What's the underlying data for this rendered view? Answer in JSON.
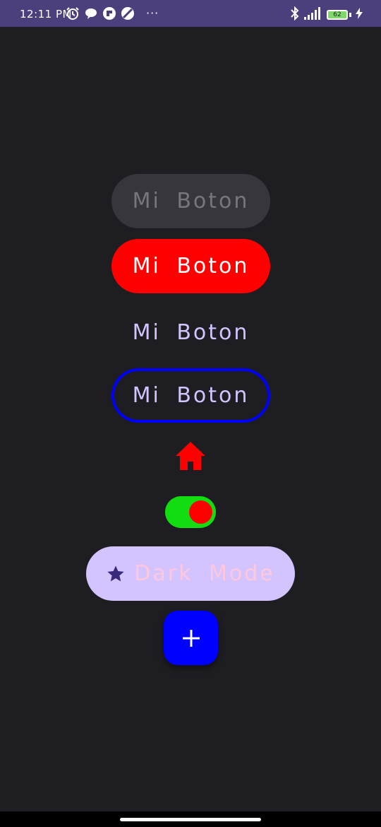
{
  "status_bar": {
    "time": "12:11 PM",
    "icons": [
      "alarm-icon",
      "chat-bubble-icon",
      "app-icon",
      "no-disturb-icon"
    ],
    "more": "···",
    "right_icons": [
      "bluetooth-icon",
      "signal-icon"
    ],
    "battery": "62",
    "charging": "lightning-icon",
    "background": "#4d3f7c"
  },
  "buttons": {
    "disabled_label": "Mi Boton",
    "filled_label": "Mi Boton",
    "text_label": "Mi Boton",
    "outlined_label": "Mi Boton"
  },
  "icon_home": {
    "name": "home-icon",
    "color": "#ff0000"
  },
  "switch": {
    "checked": true,
    "track_color": "#11dd11",
    "thumb_color": "#ff0000"
  },
  "extended_fab": {
    "icon": "star-icon",
    "label": "Dark Mode"
  },
  "fab": {
    "icon": "plus-icon",
    "color": "#0000ff"
  },
  "colors": {
    "background": "#1e1d22",
    "accent_lavender": "#d3c4ff",
    "red": "#ff0000",
    "blue": "#0000ff"
  }
}
